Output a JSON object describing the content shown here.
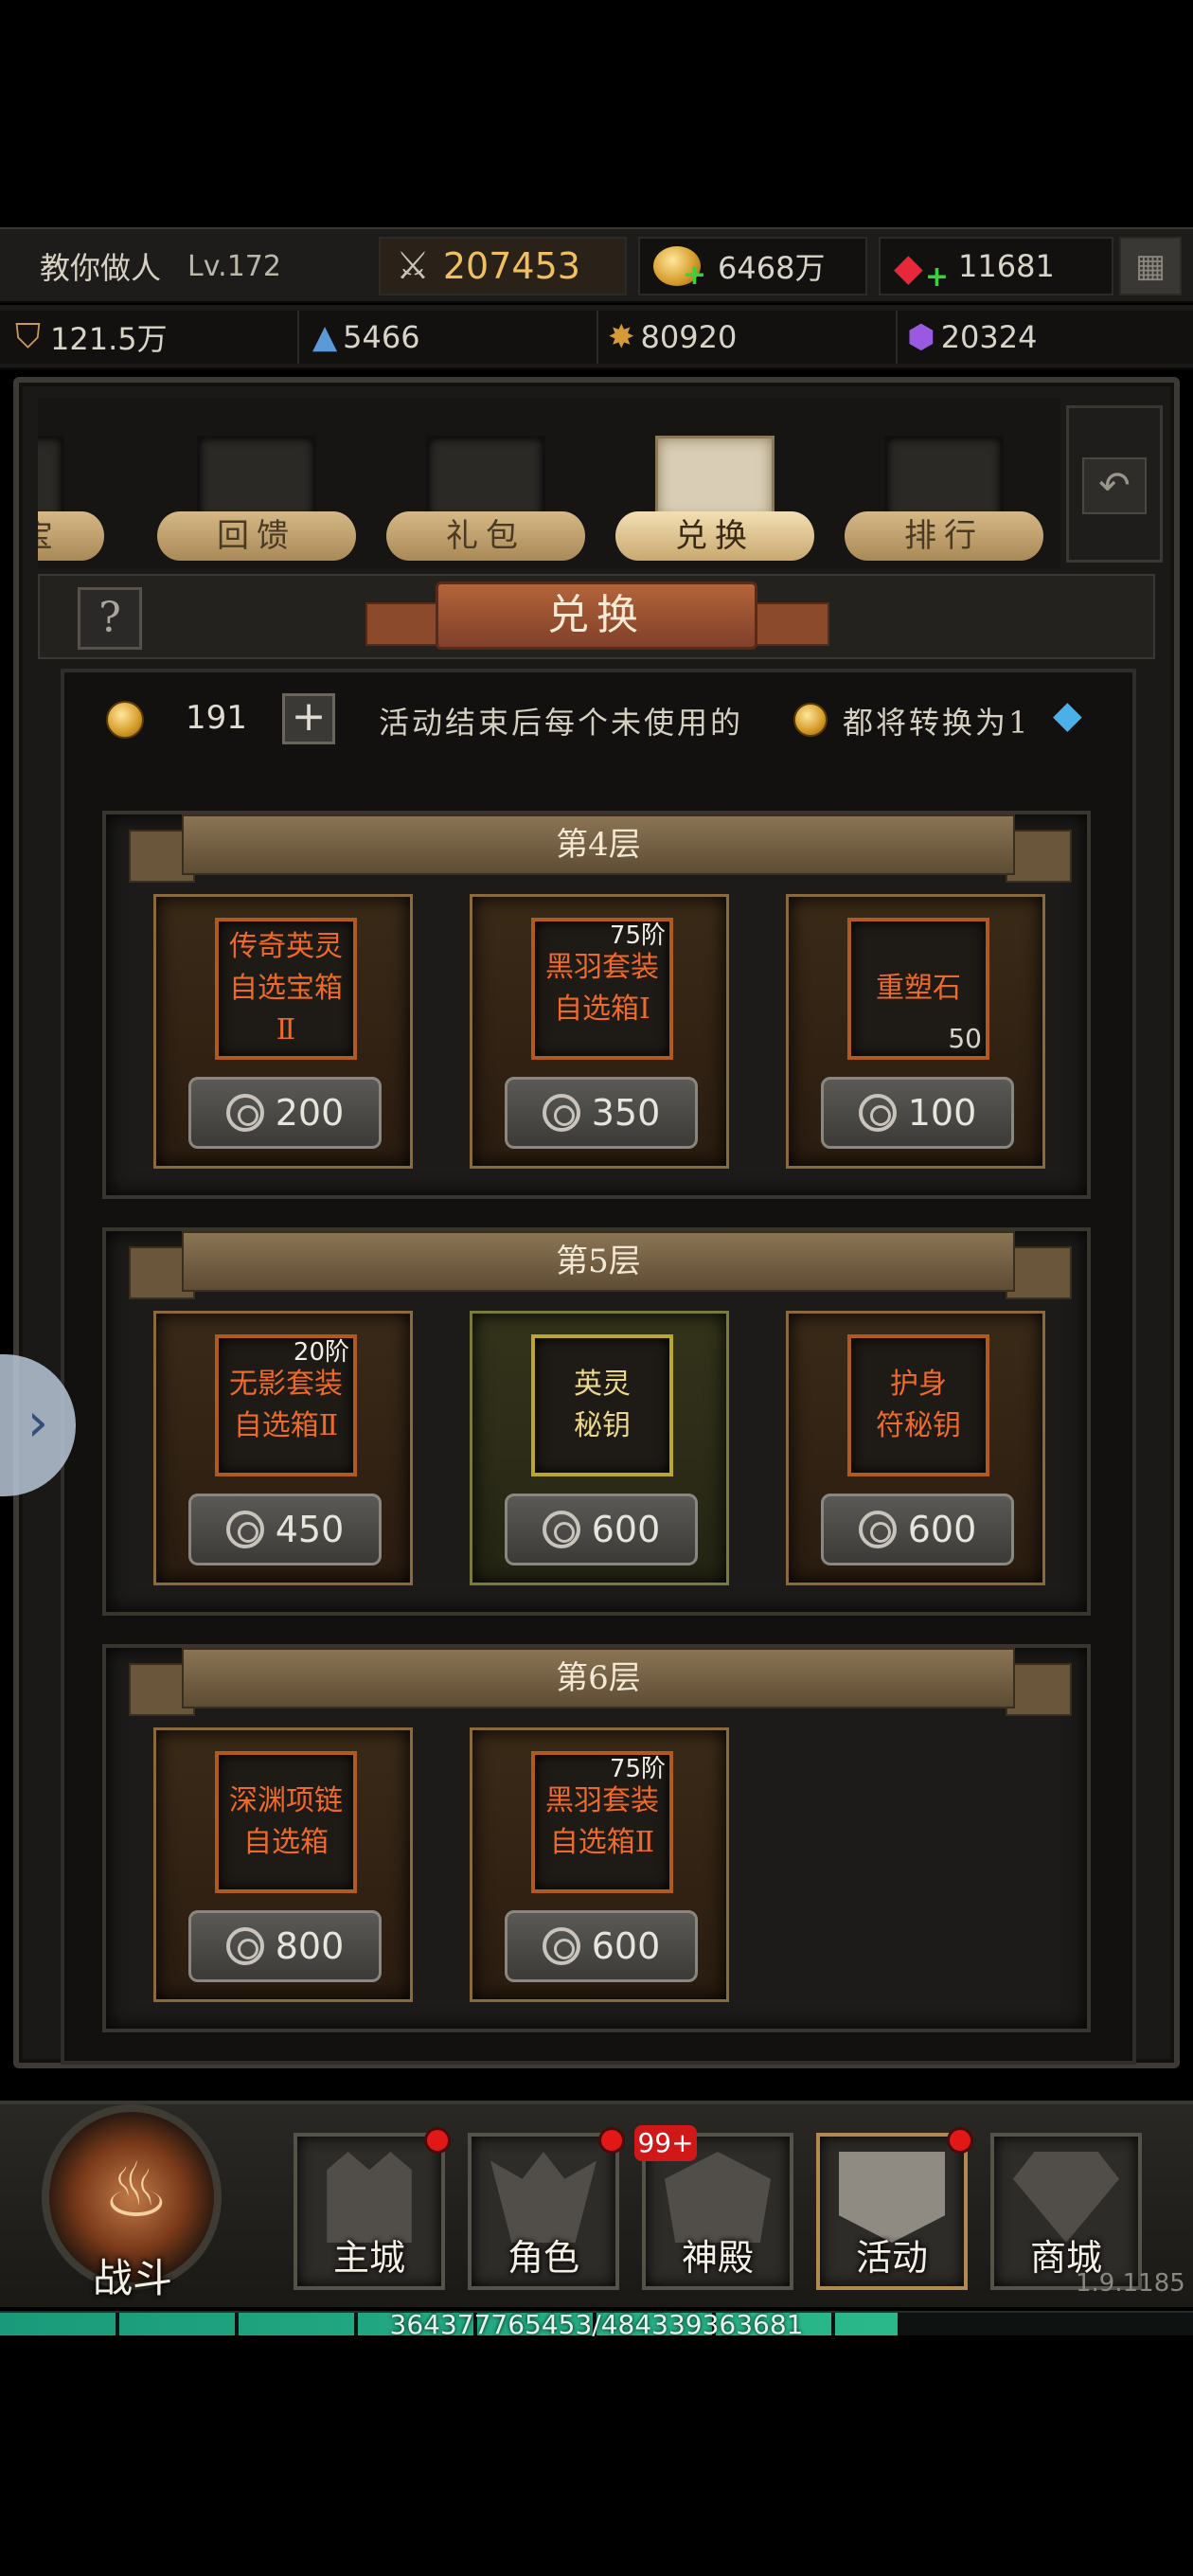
{
  "player": {
    "name": "教你做人",
    "level": "Lv.172",
    "power": "207453",
    "gold": "6468万",
    "gems": "11681"
  },
  "resources": {
    "shield": "121.5万",
    "crystal": "5466",
    "star": "80920",
    "purple": "20324"
  },
  "tabs": [
    {
      "label": "宝",
      "active": false
    },
    {
      "label": "回馈",
      "active": false
    },
    {
      "label": "礼包",
      "active": false
    },
    {
      "label": "兑换",
      "active": true
    },
    {
      "label": "排行",
      "active": false
    }
  ],
  "page": {
    "title": "兑换",
    "help": "?",
    "coin_count": "191",
    "notice_part1": "活动结束后每个未使用的",
    "notice_part2": "都将转换为1"
  },
  "floors": [
    {
      "title": "第4层",
      "items": [
        {
          "name": "传奇英灵\n自选宝箱\nⅡ",
          "grade": "",
          "qty": "",
          "price": "200"
        },
        {
          "name": "黑羽套装\n自选箱Ⅰ",
          "grade": "75阶",
          "qty": "",
          "price": "350"
        },
        {
          "name": "重塑石",
          "grade": "",
          "qty": "50",
          "price": "100"
        }
      ]
    },
    {
      "title": "第5层",
      "items": [
        {
          "name": "无影套装\n自选箱Ⅱ",
          "grade": "20阶",
          "qty": "",
          "price": "450"
        },
        {
          "name": "英灵\n秘钥",
          "grade": "",
          "qty": "",
          "price": "600"
        },
        {
          "name": "护身\n符秘钥",
          "grade": "",
          "qty": "",
          "price": "600"
        }
      ]
    },
    {
      "title": "第6层",
      "items": [
        {
          "name": "深渊项链\n自选箱",
          "grade": "",
          "qty": "",
          "price": "800"
        },
        {
          "name": "黑羽套装\n自选箱Ⅱ",
          "grade": "75阶",
          "qty": "",
          "price": "600"
        }
      ]
    }
  ],
  "nav": {
    "battle": "战斗",
    "items": [
      "主城",
      "角色",
      "神殿",
      "活动",
      "商城"
    ],
    "badge": "99+",
    "version": "1.9.1185"
  },
  "xp": {
    "text": "364377765453/484339363681",
    "fraction": 0.752
  }
}
